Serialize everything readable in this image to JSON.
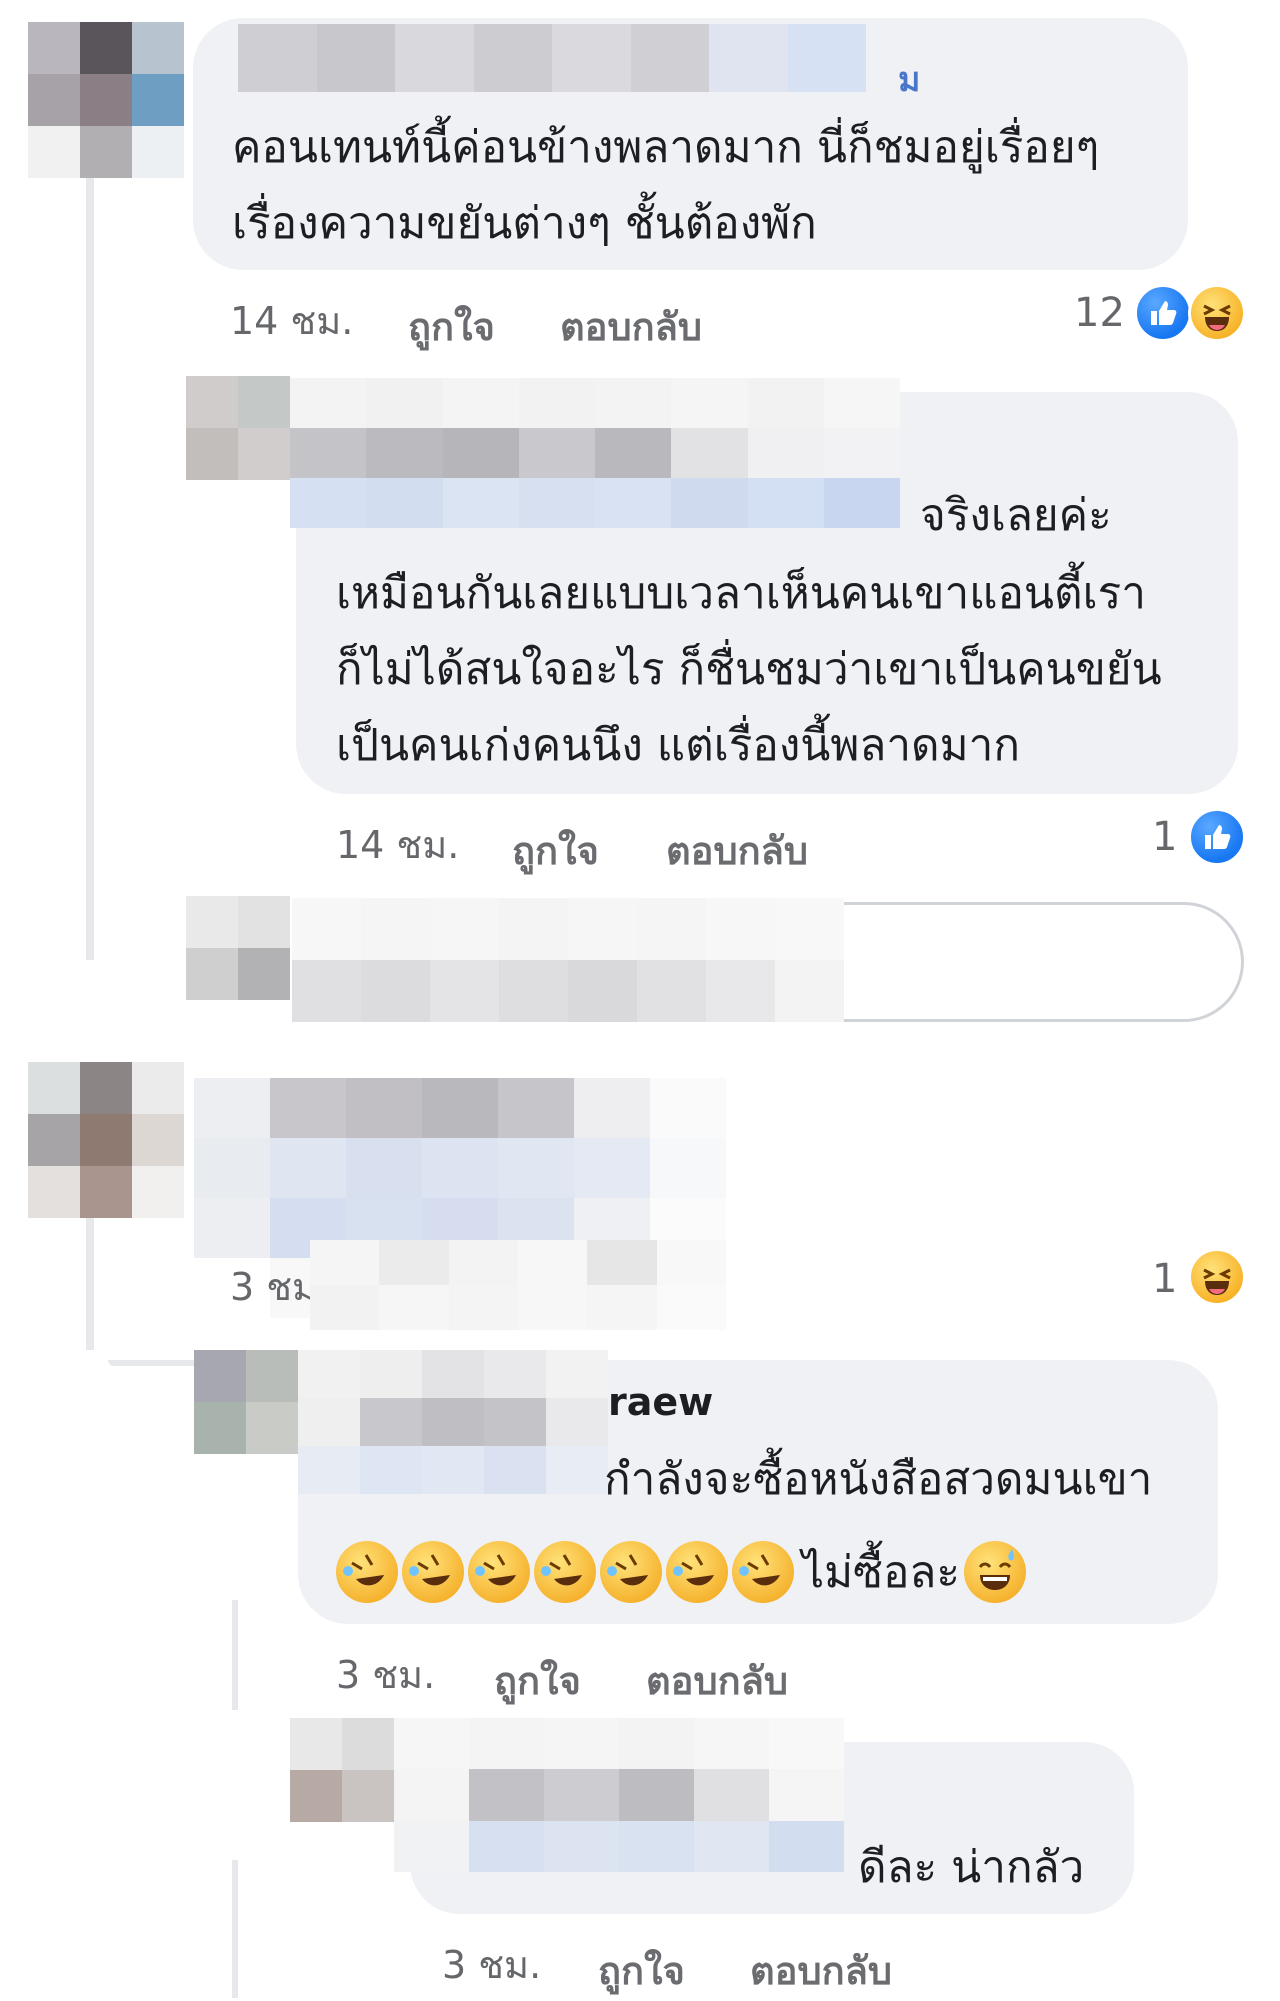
{
  "comments": [
    {
      "text_line1": "คอนเทนท์นี้ค่อนข้างพลาดมาก นี่ก็ชมอยู่เรื่อยๆ",
      "text_line2": "เรื่องความขยันต่างๆ ชั้นต้องพัก",
      "author_suffix": "ม",
      "time": "14 ชม.",
      "like_label": "ถูกใจ",
      "reply_label": "ตอบกลับ",
      "reaction_count": "12",
      "reactions": [
        "like-icon",
        "haha-icon"
      ]
    },
    {
      "text_line1": "จริงเลยค่ะ",
      "text_line2": "เหมือนกันเลยแบบเวลาเห็นคนเขาแอนตี้เรา",
      "text_line3": "ก็ไม่ได้สนใจอะไร  ก็ชื่นชมว่าเขาเป็นคนขยัน",
      "text_line4": "เป็นคนเก่งคนนึง แต่เรื่องนี้พลาดมาก",
      "time": "14 ชม.",
      "like_label": "ถูกใจ",
      "reply_label": "ตอบกลับ",
      "reaction_count": "1",
      "reactions": [
        "like-icon"
      ]
    },
    {
      "time": "3 ชม",
      "reaction_count": "1",
      "reactions": [
        "haha-icon"
      ]
    },
    {
      "author_suffix": "raew",
      "text_line1": "กำลังจะซื้อหนังสือสวดมนเขา",
      "emoji_tail": "ไม่ซื้อละ",
      "time": "3 ชม.",
      "like_label": "ถูกใจ",
      "reply_label": "ตอบกลับ"
    },
    {
      "text_line1": "ดีละ น่ากลัว",
      "time": "3 ชม.",
      "like_label": "ถูกใจ",
      "reply_label": "ตอบกลับ"
    }
  ],
  "colors": {
    "bubble": "#eff1f4",
    "meta_text": "#65676b",
    "like_blue": "#1877f2",
    "haha_yellow": "#f7b125"
  }
}
